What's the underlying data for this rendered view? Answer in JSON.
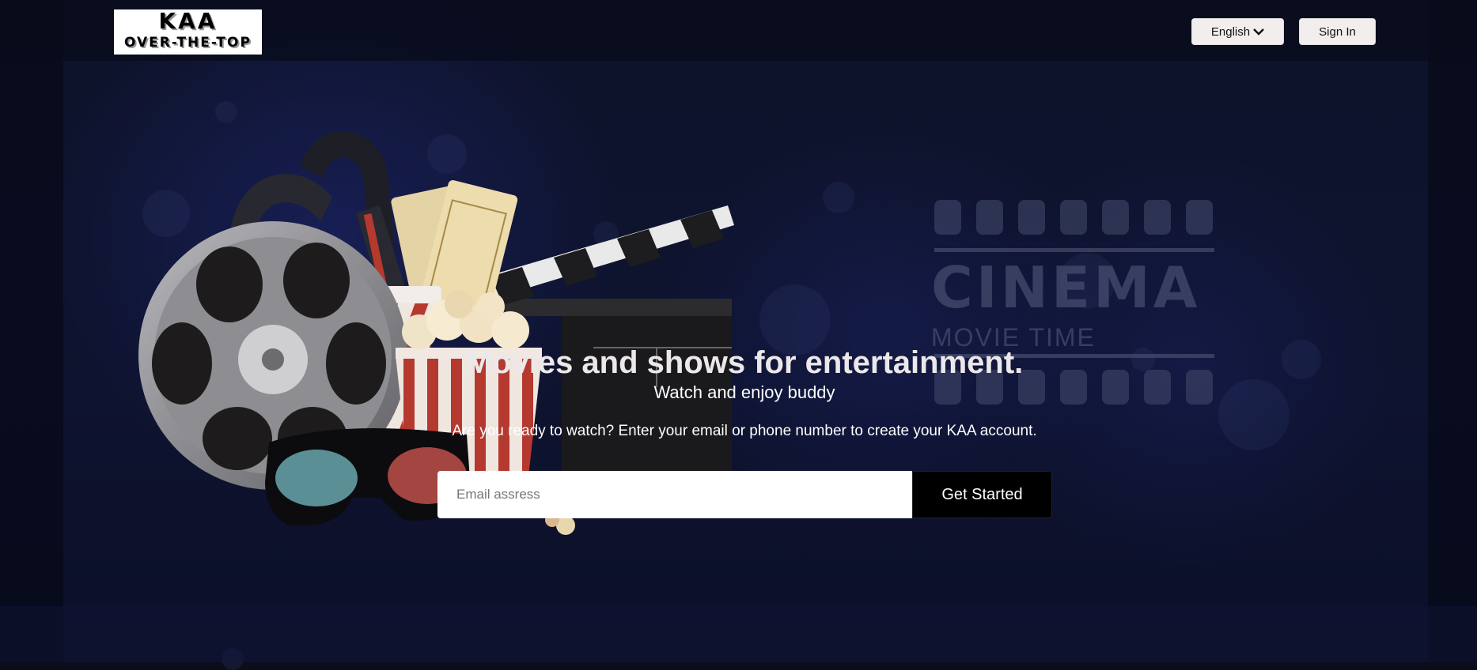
{
  "logo": {
    "line1": "KAA",
    "line2": "OVER-THE-TOP"
  },
  "header": {
    "language_label": "English",
    "language_icon": "chevron-down-icon",
    "signin_label": "Sign In"
  },
  "background": {
    "cinema_title": "CINEMA",
    "cinema_subtitle": "MOVIE TIME"
  },
  "hero": {
    "title": "Movies and shows for entertainment.",
    "subtitle": "Watch and enjoy buddy",
    "cta_text": "Are you ready to watch? Enter your email or phone number to create your KAA account.",
    "email_placeholder": "Email assress",
    "get_started_label": "Get Started"
  },
  "colors": {
    "button_bg": "#f3eeee",
    "cta_bg": "#000000",
    "page_bg": "#12173a"
  }
}
